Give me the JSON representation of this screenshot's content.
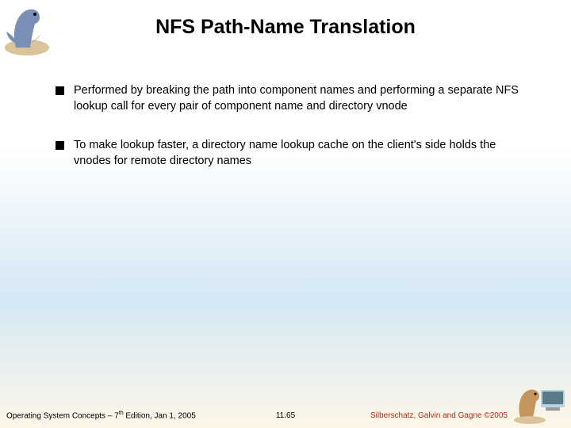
{
  "title": "NFS Path-Name Translation",
  "bullets": [
    "Performed by breaking the path into component names and performing a separate NFS lookup call for every pair of component name and directory vnode",
    "To make lookup faster, a directory name lookup cache on the client's side holds the vnodes for remote directory names"
  ],
  "footer": {
    "left_prefix": "Operating System Concepts – 7",
    "left_sup": "th",
    "left_suffix": " Edition, Jan 1, 2005",
    "center": "11.65",
    "right": "Silberschatz, Galvin and Gagne ©2005"
  }
}
